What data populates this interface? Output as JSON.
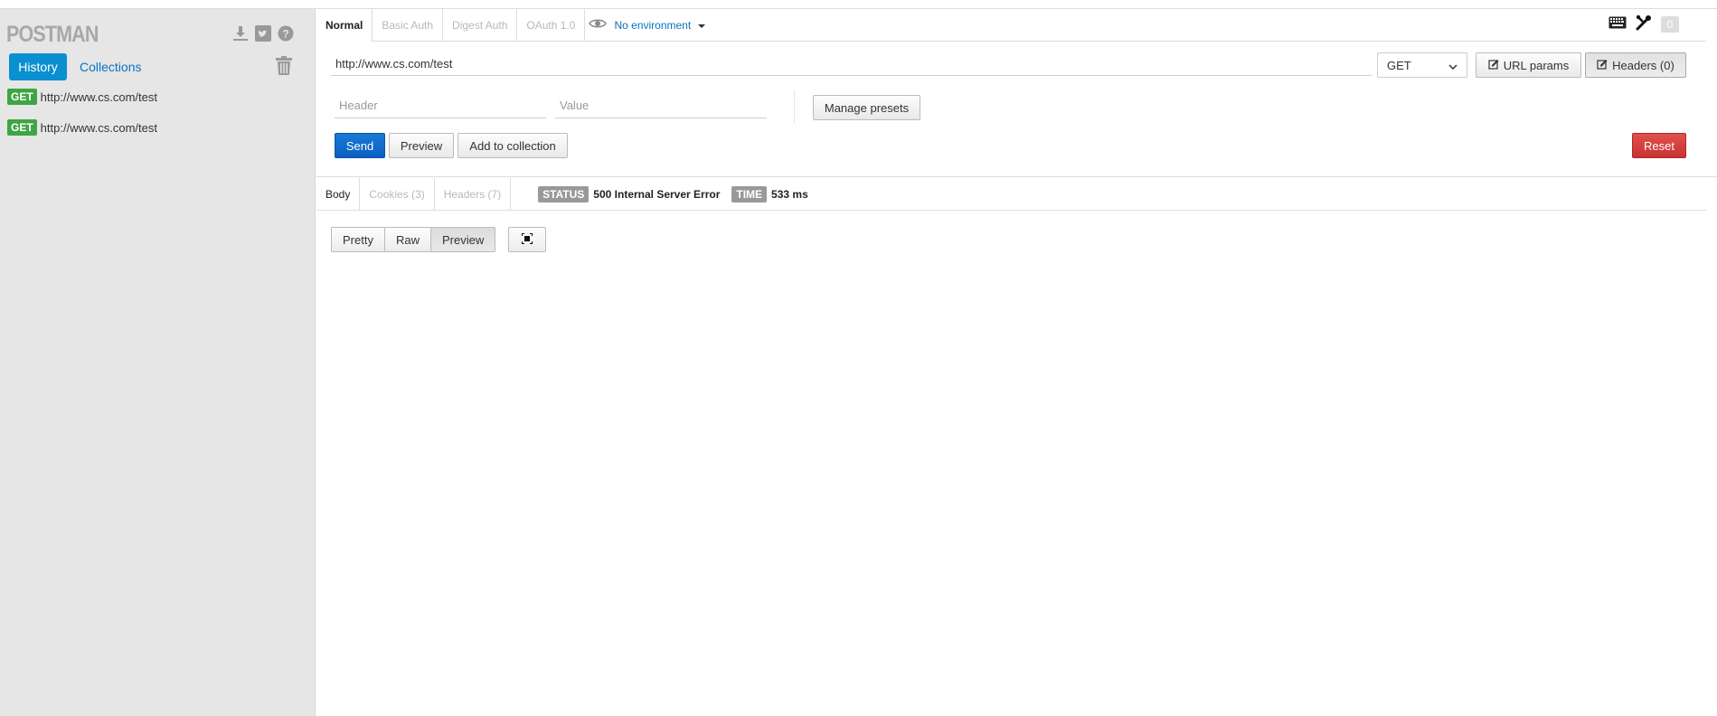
{
  "app": {
    "logo": "POSTMAN"
  },
  "sidebar": {
    "tabs": {
      "history": "History",
      "collections": "Collections"
    },
    "history": [
      {
        "method": "GET",
        "url": "http://www.cs.com/test"
      },
      {
        "method": "GET",
        "url": "http://www.cs.com/test"
      }
    ]
  },
  "auth_tabs": {
    "normal": "Normal",
    "basic": "Basic Auth",
    "digest": "Digest Auth",
    "oauth": "OAuth 1.0"
  },
  "environment": {
    "label": "No environment"
  },
  "top_right": {
    "badge_count": "0"
  },
  "request": {
    "url": "http://www.cs.com/test",
    "method": "GET",
    "url_params_label": "URL params",
    "headers_label": "Headers (0)",
    "header_placeholder": "Header",
    "value_placeholder": "Value",
    "manage_presets_label": "Manage presets",
    "send_label": "Send",
    "preview_label": "Preview",
    "add_to_collection_label": "Add to collection",
    "reset_label": "Reset"
  },
  "response": {
    "tabs": {
      "body": "Body",
      "cookies": "Cookies (3)",
      "headers": "Headers (7)"
    },
    "status_label": "STATUS",
    "status_value": "500 Internal Server Error",
    "time_label": "TIME",
    "time_value": "533 ms",
    "formats": {
      "pretty": "Pretty",
      "raw": "Raw",
      "preview": "Preview"
    }
  },
  "colors": {
    "accent": "#0a8fd1",
    "get_badge": "#3fa544",
    "send": "#0a5fc1",
    "reset": "#c73232"
  }
}
